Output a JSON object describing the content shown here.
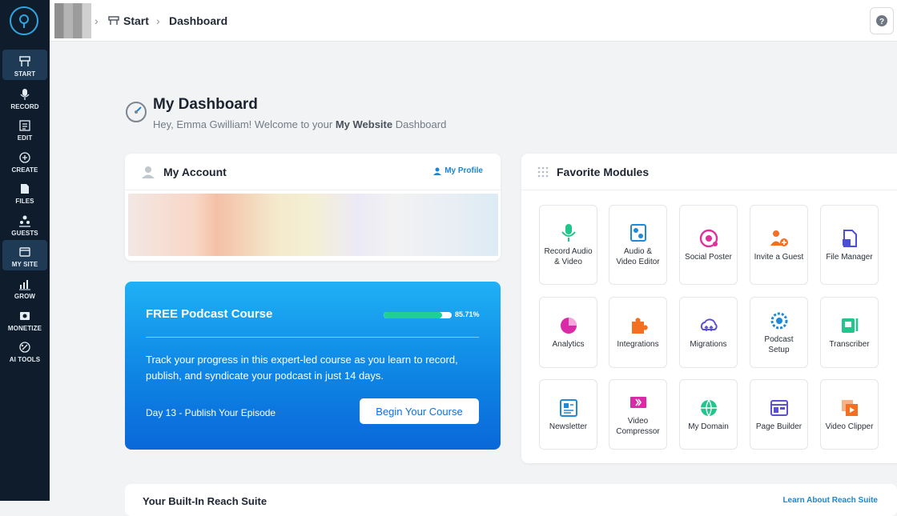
{
  "sidebar": {
    "items": [
      {
        "label": "START",
        "icon": "start-icon",
        "active": true
      },
      {
        "label": "RECORD",
        "icon": "mic-icon"
      },
      {
        "label": "EDIT",
        "icon": "edit-icon"
      },
      {
        "label": "CREATE",
        "icon": "create-icon"
      },
      {
        "label": "FILES",
        "icon": "files-icon"
      },
      {
        "label": "GUESTS",
        "icon": "guests-icon"
      },
      {
        "label": "MY SITE",
        "icon": "site-icon",
        "active": true
      },
      {
        "label": "GROW",
        "icon": "chart-icon"
      },
      {
        "label": "MONETIZE",
        "icon": "monetize-icon"
      },
      {
        "label": "AI TOOLS",
        "icon": "ai-icon"
      }
    ]
  },
  "topbar": {
    "breadcrumb": [
      "Start",
      "Dashboard"
    ]
  },
  "header": {
    "title": "My Dashboard",
    "greeting": "Hey, Emma Gwilliam! Welcome to your",
    "site_name": "My Website",
    "suffix": "Dashboard"
  },
  "account": {
    "title": "My Account",
    "profile_link": "My Profile"
  },
  "course": {
    "title": "FREE Podcast Course",
    "progress": 0.8571,
    "progress_text": "85.71%",
    "description": "Track your progress in this expert-led course as you learn to record, publish, and syndicate your podcast in just 14 days.",
    "day": "Day 13 - Publish Your Episode",
    "button": "Begin Your Course"
  },
  "modules": {
    "title": "Favorite Modules",
    "items": [
      {
        "label": "Record Audio & Video",
        "icon": "mic-icon",
        "color": "#22c58b"
      },
      {
        "label": "Audio & Video Editor",
        "icon": "editor-icon",
        "color": "#1f8ad8"
      },
      {
        "label": "Social Poster",
        "icon": "social-icon",
        "color": "#e0309a"
      },
      {
        "label": "Invite a Guest",
        "icon": "invite-icon",
        "color": "#f36f21"
      },
      {
        "label": "File Manager",
        "icon": "file-icon",
        "color": "#4b4fd6"
      },
      {
        "label": "Analytics",
        "icon": "pie-icon",
        "color": "#d92aa8"
      },
      {
        "label": "Integrations",
        "icon": "puzzle-icon",
        "color": "#f36f21"
      },
      {
        "label": "Migrations",
        "icon": "cloud-icon",
        "color": "#5b4fd6"
      },
      {
        "label": "Podcast Setup",
        "icon": "gear-icon",
        "color": "#1f8ad8"
      },
      {
        "label": "Transcriber",
        "icon": "transcribe-icon",
        "color": "#22c58b"
      },
      {
        "label": "Newsletter",
        "icon": "newsletter-icon",
        "color": "#1f8ad8"
      },
      {
        "label": "Video Compressor",
        "icon": "compress-icon",
        "color": "#d92aa8"
      },
      {
        "label": "My Domain",
        "icon": "globe-icon",
        "color": "#22c58b"
      },
      {
        "label": "Page Builder",
        "icon": "page-icon",
        "color": "#5b4fd6"
      },
      {
        "label": "Video Clipper",
        "icon": "clipper-icon",
        "color": "#f36f21"
      }
    ]
  },
  "bottom": {
    "title": "Your Built-In Reach Suite",
    "link": "Learn About Reach Suite"
  },
  "colors": {
    "sidebar_bg": "#0f1c2b",
    "accent": "#1a86d6",
    "progress": "#21cf93"
  }
}
